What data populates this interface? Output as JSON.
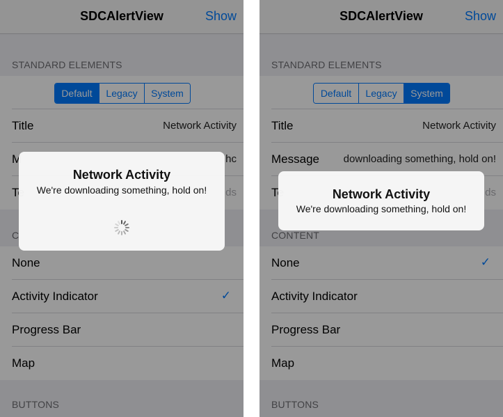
{
  "nav": {
    "title": "SDCAlertView",
    "show_label": "Show"
  },
  "sections": {
    "standard": "STANDARD ELEMENTS",
    "content": "CONTENT",
    "buttons": "BUTTONS"
  },
  "segments": [
    "Default",
    "Legacy",
    "System"
  ],
  "left": {
    "selected_segment": "Default",
    "title_value": "Network Activity",
    "message_label": "M",
    "message_value": "hc",
    "third_label": "Te",
    "third_placeholder": "ds",
    "content_header": "C"
  },
  "right": {
    "selected_segment": "System",
    "title_value": "Network Activity",
    "message_label": "Message",
    "message_value": "downloading something, hold on!",
    "third_label": "Te",
    "third_placeholder": "ds"
  },
  "fields": {
    "title_label": "Title"
  },
  "content_options": [
    "None",
    "Activity Indicator",
    "Progress Bar",
    "Map"
  ],
  "left_checked": "Activity Indicator",
  "right_checked": "None",
  "alert": {
    "title": "Network Activity",
    "message": "We're downloading something, hold on!"
  },
  "icons": {
    "checkmark": "checkmark-icon",
    "spinner": "activity-spinner-icon"
  },
  "colors": {
    "accent": "#007aff",
    "dim": "rgba(0,0,0,0.40)"
  }
}
